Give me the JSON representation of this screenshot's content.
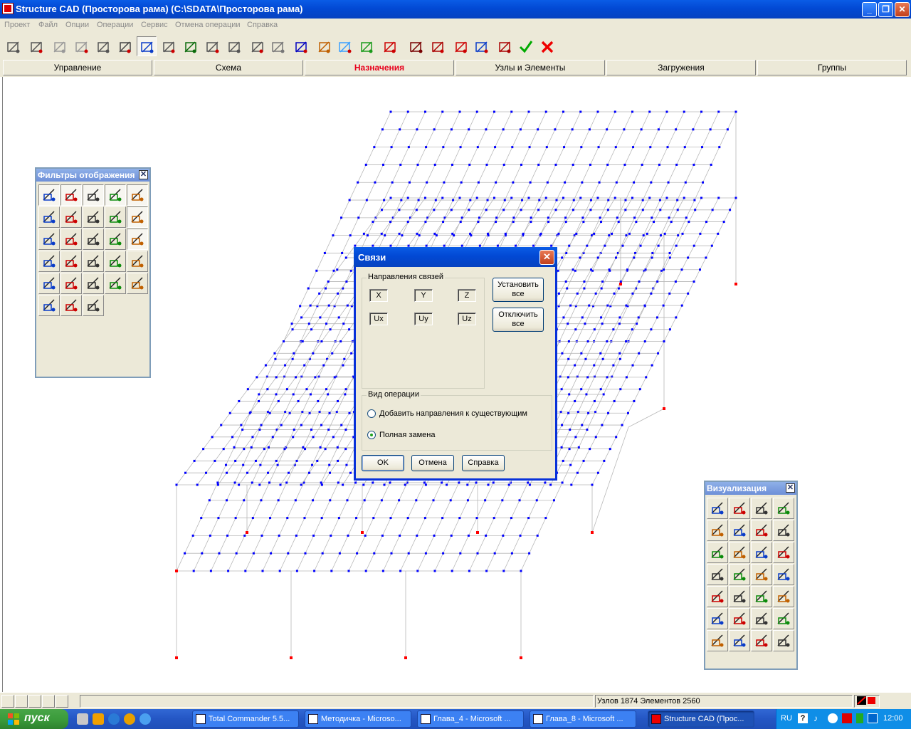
{
  "window": {
    "title": "Structure CAD (Просторова рама) (C:\\SDATA\\Просторова рама)",
    "minimize": "_",
    "restore": "❐",
    "close": "✕"
  },
  "menu": [
    "Проект",
    "Файл",
    "Опции",
    "Операции",
    "Сервис",
    "Отмена операции",
    "Справка"
  ],
  "tabs": [
    "Управление",
    "Схема",
    "Назначения",
    "Узлы и Элементы",
    "Загружения",
    "Группы"
  ],
  "active_tab": "Назначения",
  "display_filters": {
    "title": "Фильтры отображения",
    "close": "✕"
  },
  "visualization": {
    "title": "Визуализация",
    "close": "✕"
  },
  "dialog": {
    "title": "Связи",
    "close": "✕",
    "directions_group": "Направления связей",
    "directions": [
      "X",
      "Y",
      "Z",
      "Ux",
      "Uy",
      "Uz"
    ],
    "set_all": "Установить все",
    "clear_all": "Отключить все",
    "operation_group": "Вид операции",
    "option_add": "Добавить направления к существующим",
    "option_replace": "Полная замена",
    "selected_option": "Полная замена",
    "ok": "OK",
    "cancel": "Отмена",
    "help": "Справка"
  },
  "status": {
    "info": "Узлов 1874 Элементов 2560"
  },
  "taskbar": {
    "start": "пуск",
    "tasks": [
      "Total Commander 5.5...",
      "Методичка - Microso...",
      "Глава_4 - Microsoft ...",
      "Глава_8 - Microsoft ...",
      "Structure CAD (Прос..."
    ],
    "active_task": "Structure CAD (Прос...",
    "language": "RU",
    "clock": "12:00"
  },
  "colors": {
    "node": "#0000ff",
    "support_node": "#ff0000",
    "grid_line": "#b8b8b8",
    "active_tab": "#e8001c",
    "titlebar": "#0a5ce6"
  }
}
